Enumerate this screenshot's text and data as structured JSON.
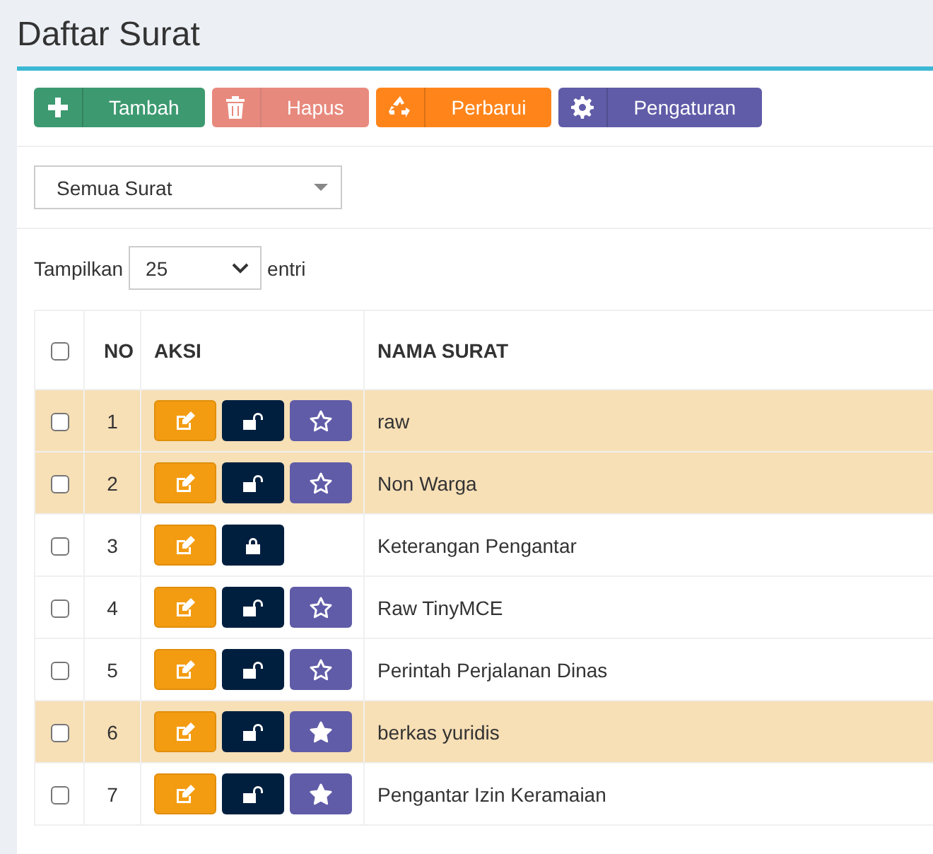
{
  "page_title": "Daftar Surat",
  "toolbar": [
    {
      "kind": "add",
      "label": "Tambah"
    },
    {
      "kind": "delete",
      "label": "Hapus",
      "disabled": true
    },
    {
      "kind": "refresh",
      "label": "Perbarui"
    },
    {
      "kind": "settings",
      "label": "Pengaturan"
    }
  ],
  "filter": {
    "value": "Semua Surat"
  },
  "page_size": {
    "label": "Tampilkan",
    "value": "25",
    "suffix": "entri"
  },
  "table": {
    "all_checked": false,
    "columns": [
      "NO",
      "AKSI",
      "NAMA SURAT"
    ],
    "rows": [
      {
        "no": "1",
        "name": "raw",
        "checked": false,
        "highlighted": true,
        "locked": false,
        "favorite": false
      },
      {
        "no": "2",
        "name": "Non Warga",
        "checked": false,
        "highlighted": true,
        "locked": false,
        "favorite": false
      },
      {
        "no": "3",
        "name": "Keterangan Pengantar",
        "checked": false,
        "highlighted": false,
        "locked": true
      },
      {
        "no": "4",
        "name": "Raw TinyMCE",
        "checked": false,
        "highlighted": false,
        "locked": false,
        "favorite": false
      },
      {
        "no": "5",
        "name": "Perintah Perjalanan Dinas",
        "checked": false,
        "highlighted": false,
        "locked": false,
        "favorite": false
      },
      {
        "no": "6",
        "name": "berkas yuridis",
        "checked": false,
        "highlighted": true,
        "locked": false,
        "favorite": true
      },
      {
        "no": "7",
        "name": "Pengantar Izin Keramaian",
        "checked": false,
        "highlighted": false,
        "locked": false,
        "favorite": true
      }
    ]
  }
}
